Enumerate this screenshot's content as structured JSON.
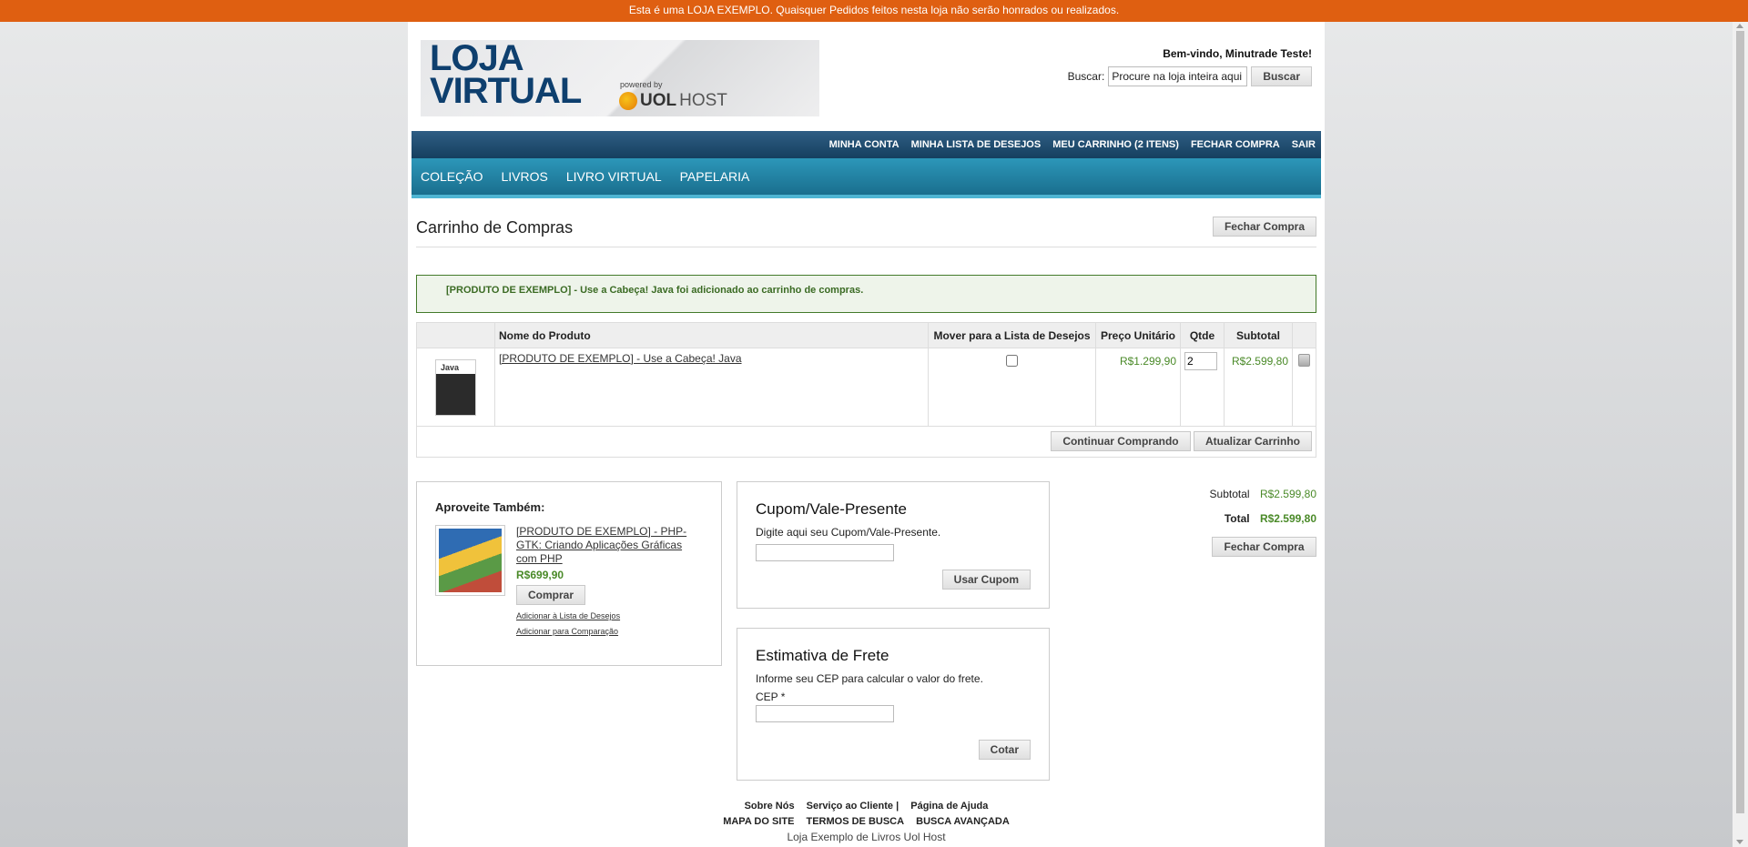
{
  "notice": "Esta é uma LOJA EXEMPLO. Quaisquer Pedidos feitos nesta loja não serão honrados ou realizados.",
  "logo": {
    "line1": "LOJA",
    "line2": "VIRTUAL",
    "powered": "powered by",
    "uol": "UOL",
    "host": "HOST"
  },
  "header": {
    "welcome": "Bem-vindo, Minutrade Teste!",
    "search_label": "Buscar:",
    "search_placeholder": "Procure na loja inteira aqui",
    "search_button": "Buscar"
  },
  "topnav": [
    "MINHA CONTA",
    "MINHA LISTA DE DESEJOS",
    "MEU CARRINHO (2 ITENS)",
    "FECHAR COMPRA",
    "SAIR"
  ],
  "mainnav": [
    "COLEÇÃO",
    "LIVROS",
    "LIVRO VIRTUAL",
    "PAPELARIA"
  ],
  "cart": {
    "title": "Carrinho de Compras",
    "checkout_button": "Fechar Compra",
    "success": "[PRODUTO DE EXEMPLO] - Use a Cabeça! Java foi adicionado ao carrinho de compras.",
    "headers": {
      "name": "Nome do Produto",
      "wishlist": "Mover para a Lista de Desejos",
      "unit": "Preço Unitário",
      "qty": "Qtde",
      "subtotal": "Subtotal"
    },
    "item": {
      "name": "[PRODUTO DE EXEMPLO] - Use a Cabeça! Java",
      "thumb_label": "Java",
      "unit_price": "R$1.299,90",
      "qty": "2",
      "subtotal": "R$2.599,80"
    },
    "continue_button": "Continuar Comprando",
    "update_button": "Atualizar Carrinho"
  },
  "also": {
    "title": "Aproveite Também:",
    "name": "[PRODUTO DE EXEMPLO] - PHP-GTK: Criando Aplicações Gráficas com PHP",
    "price": "R$699,90",
    "buy": "Comprar",
    "wishlist": "Adicionar à Lista de Desejos",
    "compare": "Adicionar para Comparação"
  },
  "coupon": {
    "title": "Cupom/Vale-Presente",
    "text": "Digite aqui seu Cupom/Vale-Presente.",
    "button": "Usar Cupom"
  },
  "shipping": {
    "title": "Estimativa de Frete",
    "text": "Informe seu CEP para calcular o valor do frete.",
    "cep_label": "CEP *",
    "button": "Cotar"
  },
  "totals": {
    "subtotal_label": "Subtotal",
    "subtotal": "R$2.599,80",
    "total_label": "Total",
    "total": "R$2.599,80",
    "checkout": "Fechar Compra"
  },
  "footer": {
    "links1": [
      "Sobre Nós",
      "Serviço ao Cliente |",
      "Página de Ajuda"
    ],
    "links2": [
      "MAPA DO SITE",
      "TERMOS DE BUSCA",
      "BUSCA AVANÇADA"
    ],
    "copyright": "Loja Exemplo de Livros Uol Host"
  }
}
